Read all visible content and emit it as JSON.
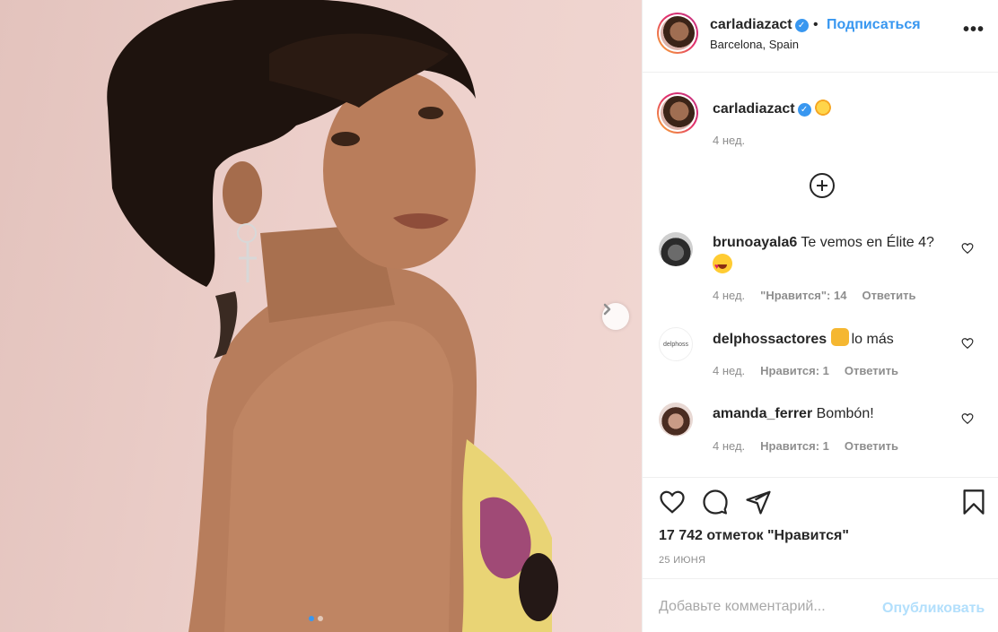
{
  "post": {
    "author": "carladiazact",
    "follow_label": "Подписаться",
    "separator": "•",
    "location": "Barcelona, Spain",
    "more_label": "•••",
    "verified_mark": "✓"
  },
  "caption": {
    "author": "carladiazact",
    "emoji": "sun-with-face",
    "time": "4 нед."
  },
  "comments": [
    {
      "author": "brunoayala6",
      "text": "Te vemos en Élite 4?",
      "emoji": "heart-eyes",
      "time": "4 нед.",
      "likes": "\"Нравится\": 14",
      "reply": "Ответить"
    },
    {
      "author": "delphossactores",
      "text": "lo más",
      "emoji": "raising-hands",
      "time": "4 нед.",
      "likes": "Нравится: 1",
      "reply": "Ответить",
      "avatar_text": "delphoss"
    },
    {
      "author": "amanda_ferrer",
      "text": "Bombón!",
      "time": "4 нед.",
      "likes": "Нравится: 1",
      "reply": "Ответить"
    }
  ],
  "stats": {
    "likes": "17 742 отметок \"Нравится\"",
    "date": "25 ИЮНЯ"
  },
  "comment_box": {
    "placeholder": "Добавьте комментарий...",
    "publish": "Опубликовать"
  },
  "carousel": {
    "current": 1,
    "total": 2
  },
  "colors": {
    "accent": "#3897f0",
    "text": "#262626",
    "muted": "#8e8e8e",
    "publish_disabled": "#b2dffc"
  }
}
